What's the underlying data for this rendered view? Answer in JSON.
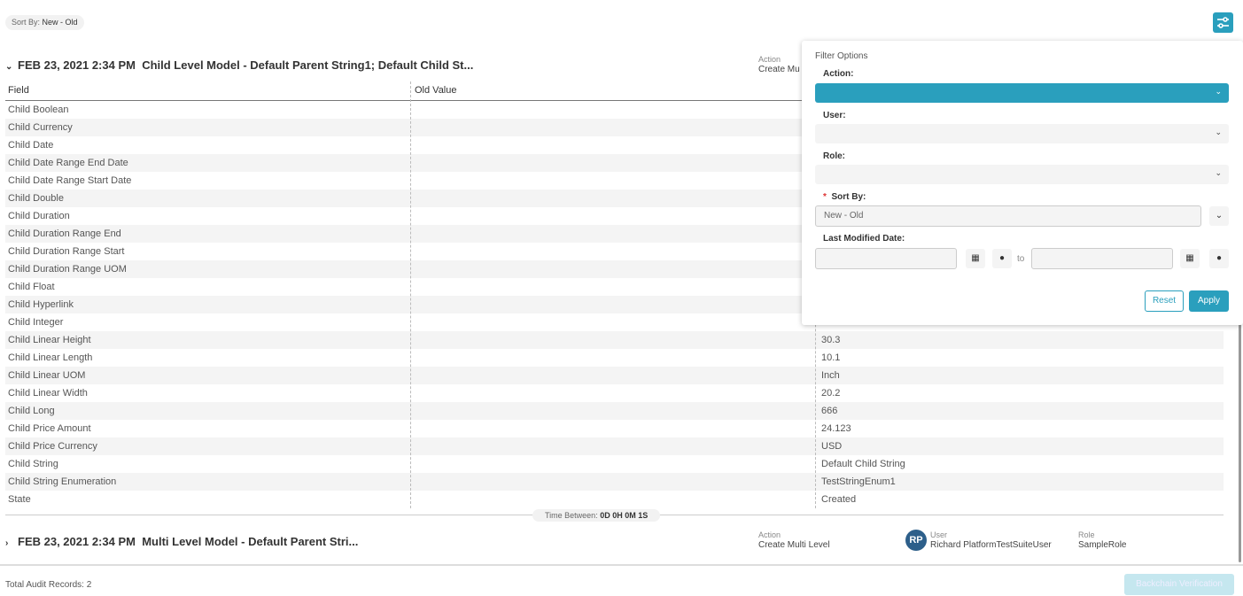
{
  "sort_chip": {
    "label": "Sort By:",
    "value": "New - Old"
  },
  "records": [
    {
      "datetime": "FEB 23, 2021 2:34 PM",
      "title": "Child Level Model - Default Parent String1; Default Child St...",
      "action_label": "Action",
      "action": "Create Mu",
      "expanded": true
    },
    {
      "datetime": "FEB 23, 2021 2:34 PM",
      "title": "Multi Level Model - Default Parent Stri...",
      "action_label": "Action",
      "action": "Create Multi Level",
      "user_label": "User",
      "user": "Richard PlatformTestSuiteUser",
      "user_initials": "RP",
      "role_label": "Role",
      "role": "SampleRole",
      "expanded": false
    }
  ],
  "table": {
    "headers": {
      "field": "Field",
      "old": "Old Value"
    },
    "rows": [
      {
        "f": "Child Boolean",
        "o": "",
        "n": ""
      },
      {
        "f": "Child Currency",
        "o": "",
        "n": ""
      },
      {
        "f": "Child Date",
        "o": "",
        "n": ""
      },
      {
        "f": "Child Date Range End Date",
        "o": "",
        "n": ""
      },
      {
        "f": "Child Date Range Start Date",
        "o": "",
        "n": ""
      },
      {
        "f": "Child Double",
        "o": "",
        "n": ""
      },
      {
        "f": "Child Duration",
        "o": "",
        "n": ""
      },
      {
        "f": "Child Duration Range End",
        "o": "",
        "n": ""
      },
      {
        "f": "Child Duration Range Start",
        "o": "",
        "n": ""
      },
      {
        "f": "Child Duration Range UOM",
        "o": "",
        "n": ""
      },
      {
        "f": "Child Float",
        "o": "",
        "n": ""
      },
      {
        "f": "Child Hyperlink",
        "o": "",
        "n": ""
      },
      {
        "f": "Child Integer",
        "o": "",
        "n": ""
      },
      {
        "f": "Child Linear Height",
        "o": "",
        "n": "30.3"
      },
      {
        "f": "Child Linear Length",
        "o": "",
        "n": "10.1"
      },
      {
        "f": "Child Linear UOM",
        "o": "",
        "n": "Inch"
      },
      {
        "f": "Child Linear Width",
        "o": "",
        "n": "20.2"
      },
      {
        "f": "Child Long",
        "o": "",
        "n": "666"
      },
      {
        "f": "Child Price Amount",
        "o": "",
        "n": "24.123"
      },
      {
        "f": "Child Price Currency",
        "o": "",
        "n": "USD"
      },
      {
        "f": "Child String",
        "o": "",
        "n": "Default Child String"
      },
      {
        "f": "Child String Enumeration",
        "o": "",
        "n": "TestStringEnum1"
      },
      {
        "f": "State",
        "o": "",
        "n": "Created"
      }
    ]
  },
  "time_between": {
    "label": "Time Between:",
    "value": "0D 0H 0M 1S"
  },
  "footer": {
    "total": "Total Audit Records: 2",
    "backchain": "Backchain Verification"
  },
  "filter": {
    "title": "Filter Options",
    "action_label": "Action:",
    "action_value": "",
    "user_label": "User:",
    "user_value": "",
    "role_label": "Role:",
    "role_value": "",
    "sort_label": "Sort By:",
    "sort_required": "*",
    "sort_value": "New - Old",
    "date_label": "Last Modified Date:",
    "date_from": "",
    "date_to": "",
    "to_label": "to",
    "reset": "Reset",
    "apply": "Apply"
  },
  "colors": {
    "accent": "#2a9fbd",
    "avatar": "#2d5f8a"
  }
}
